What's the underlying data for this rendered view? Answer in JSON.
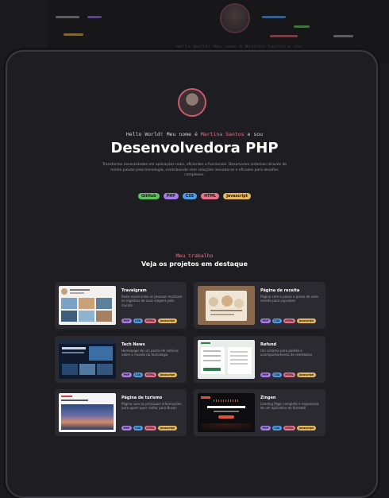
{
  "hero": {
    "greeting_prefix": "Hello World! Meu nome é",
    "name": "Martina Santos",
    "greeting_suffix": "e sou",
    "title": "Desenvolvedora PHP",
    "description": "Transformo necessidades em aplicações reais, eficientes e funcionais. Desenvolvo sistemas através de minha paixão pela tecnologia, contribuindo com soluções inovadoras e eficazes para desafios complexos.",
    "tags": [
      {
        "label": "GitHub",
        "color": "#5cc45c"
      },
      {
        "label": "PHP",
        "color": "#a77be8"
      },
      {
        "label": "CSS",
        "color": "#4f9be8"
      },
      {
        "label": "HTML",
        "color": "#e8728b"
      },
      {
        "label": "Javascript",
        "color": "#e8b95c"
      }
    ]
  },
  "background": {
    "caption": "Hello World! Meu nome é Martina Santos e sou"
  },
  "projects": {
    "label": "Meu trabalho",
    "title": "Veja os projetos em destaque",
    "items": [
      {
        "title": "Travelgram",
        "desc": "Rede social onde as pessoas mostram os registros de suas viagens pelo mundo",
        "tags": [
          "PHP",
          "CSS",
          "HTML",
          "Javascript"
        ]
      },
      {
        "title": "Página de receita",
        "desc": "Página com o passo a passo de uma receita para cupcakes",
        "tags": [
          "PHP",
          "CSS",
          "HTML",
          "Javascript"
        ]
      },
      {
        "title": "Tech News",
        "desc": "Homepage de um portal de notícias sobre o mundo da tecnologia",
        "tags": [
          "PHP",
          "CSS",
          "HTML",
          "Javascript"
        ]
      },
      {
        "title": "Refund",
        "desc": "Um sistema para pedido e acompanhamento de reembolso",
        "tags": [
          "PHP",
          "CSS",
          "HTML",
          "Javascript"
        ]
      },
      {
        "title": "Página de turismo",
        "desc": "Página com as principais informações para quem quer visitar para Busan",
        "tags": [
          "PHP",
          "CSS",
          "HTML",
          "Javascript"
        ]
      },
      {
        "title": "Zingen",
        "desc": "Landing Page completa e responsiva de um aplicativo de Karaokê",
        "tags": [
          "PHP",
          "CSS",
          "HTML",
          "Javascript"
        ]
      }
    ]
  },
  "tag_colors": {
    "PHP": "#a77be8",
    "CSS": "#4f9be8",
    "HTML": "#e8728b",
    "Javascript": "#e8b95c"
  }
}
